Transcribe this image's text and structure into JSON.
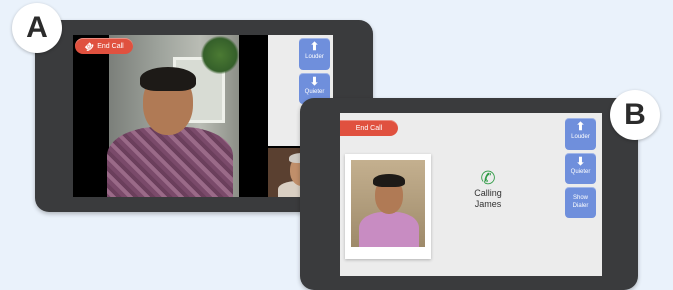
{
  "device_a": {
    "badge": "A",
    "end_call_label": "End Call",
    "louder_label": "Louder",
    "quieter_label": "Quieter"
  },
  "device_b": {
    "badge": "B",
    "end_call_label": "End Call",
    "louder_label": "Louder",
    "quieter_label": "Quieter",
    "show_dialer_label": "Show Dialer",
    "calling_line1": "Calling",
    "calling_line2": "James"
  },
  "icons": {
    "phone": "phone-icon",
    "louder": "arrow-up-icon",
    "quieter": "arrow-down-icon",
    "calling": "phone-ringing-icon"
  },
  "colors": {
    "end_call": "#e0513f",
    "side_button": "#6f8fdc",
    "device_frame": "#3a3b3d",
    "calling_icon": "#2f9b45",
    "background": "#eaf2fb"
  }
}
